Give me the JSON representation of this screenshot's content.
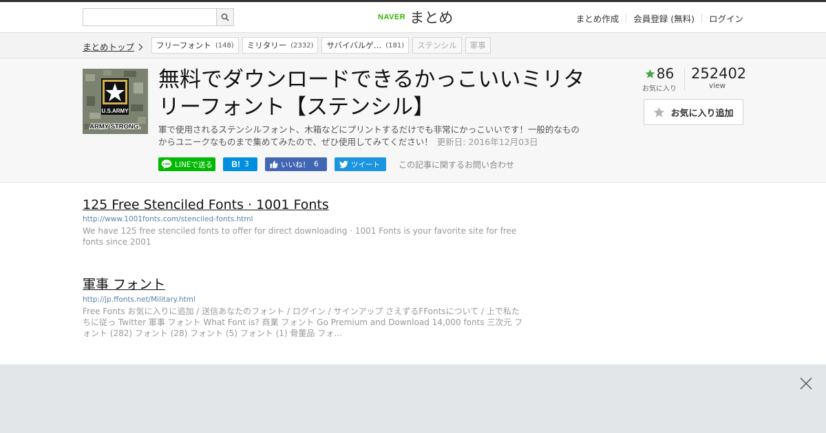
{
  "header": {
    "search": {
      "placeholder": "",
      "value": ""
    },
    "logo": {
      "brand": "NAVER",
      "product": "まとめ"
    },
    "nav": [
      {
        "label": "まとめ作成"
      },
      {
        "label": "会員登録 (無料)"
      },
      {
        "label": "ログイン"
      }
    ]
  },
  "breadcrumb": {
    "top_label": "まとめトップ",
    "tags": [
      {
        "label": "フリーフォント",
        "count": "(148)"
      },
      {
        "label": "ミリタリー",
        "count": "(2332)"
      },
      {
        "label": "サバイバルゲ…",
        "count": "(181)"
      },
      {
        "label": "ステンシル",
        "count": ""
      },
      {
        "label": "軍事",
        "count": ""
      }
    ]
  },
  "article": {
    "thumb": {
      "line1": "U.S.ARMY",
      "line2": "ARMY STRONG."
    },
    "title": "無料でダウンロードできるかっこいいミリタリーフォント【ステンシル】",
    "description": "軍で使用されるステンシルフォント、木箱などにプリントするだけでも非常にかっこいいです！一般的なものからユニークなものまで集めてみたので、ぜひ使用してみてください！",
    "updated": "更新日: 2016年12月03日",
    "share": {
      "line_label": "LINEで送る",
      "hatena_label": "B!",
      "hatena_count": "3",
      "fb_label": "いいね！",
      "fb_count": "6",
      "tweet_label": "ツイート",
      "contact_label": "この記事に関するお問い合わせ"
    },
    "stats": {
      "fav_count": "86",
      "fav_label": "お気に入り",
      "view_count": "252402",
      "view_label": "view"
    },
    "fav_button_label": "お気に入り追加"
  },
  "results": [
    {
      "title": "125 Free Stenciled Fonts · 1001 Fonts",
      "url": "http://www.1001fonts.com/stenciled-fonts.html",
      "snippet": "We have 125 free stenciled fonts to offer for direct downloading · 1001 Fonts is your favorite site for free fonts since 2001"
    },
    {
      "title": "軍事 フォント",
      "url": "http://jp.ffonts.net/Military.html",
      "snippet": "Free Fonts お気に入りに追加 / 送信あなたのフォント / ログイン / サインアップ さえずるFFontsについて / 上で私たちに従っ Twitter 軍事 フォント What Font is? 商業 フォント Go Premium and Download 14,000 fonts 三次元 フォント (282) フォント (28) フォント (5) フォント (1) 骨董品 フォ…"
    }
  ],
  "colors": {
    "line": "#00b900",
    "hatena": "#008fde",
    "facebook": "#4267b2",
    "twitter": "#1b95e0",
    "star": "#43a643"
  }
}
